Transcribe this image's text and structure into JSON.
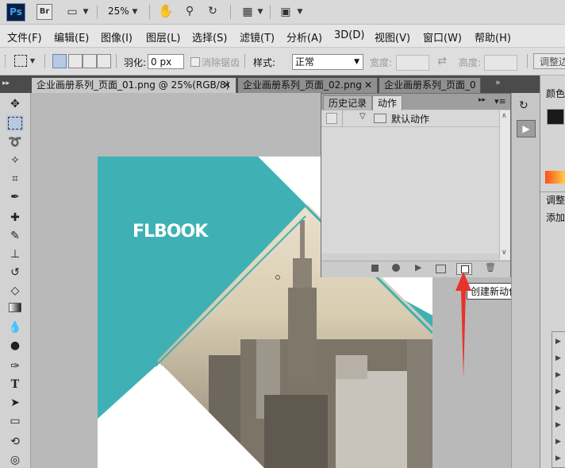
{
  "appbar": {
    "ps_logo": "Ps",
    "br_logo": "Br",
    "zoom": "25%"
  },
  "menu": [
    "文件(F)",
    "编辑(E)",
    "图像(I)",
    "图层(L)",
    "选择(S)",
    "滤镜(T)",
    "分析(A)",
    "3D(D)",
    "视图(V)",
    "窗口(W)",
    "帮助(H)"
  ],
  "options": {
    "feather_label": "羽化:",
    "feather_value": "0 px",
    "antialias_label": "消除锯齿",
    "style_label": "样式:",
    "style_value": "正常",
    "width_label": "宽度:",
    "height_label": "高度:",
    "adjust_edge_label": "调整边"
  },
  "tabs": [
    "企业画册系列_页面_01.png @ 25%(RGB/8)",
    "企业画册系列_页面_02.png",
    "企业画册系列_页面_0"
  ],
  "actions_panel": {
    "tab_history": "历史记录",
    "tab_actions": "动作",
    "set_name": "默认动作",
    "tooltip": "创建新动作"
  },
  "canvas": {
    "logo_text": "FLBOOK"
  },
  "right_panel": {
    "color_label": "颜色",
    "adjust_label": "调整",
    "add_label": "添加"
  },
  "colors": {
    "teal": "#3fb1b5",
    "accent_red": "#e8322c"
  }
}
